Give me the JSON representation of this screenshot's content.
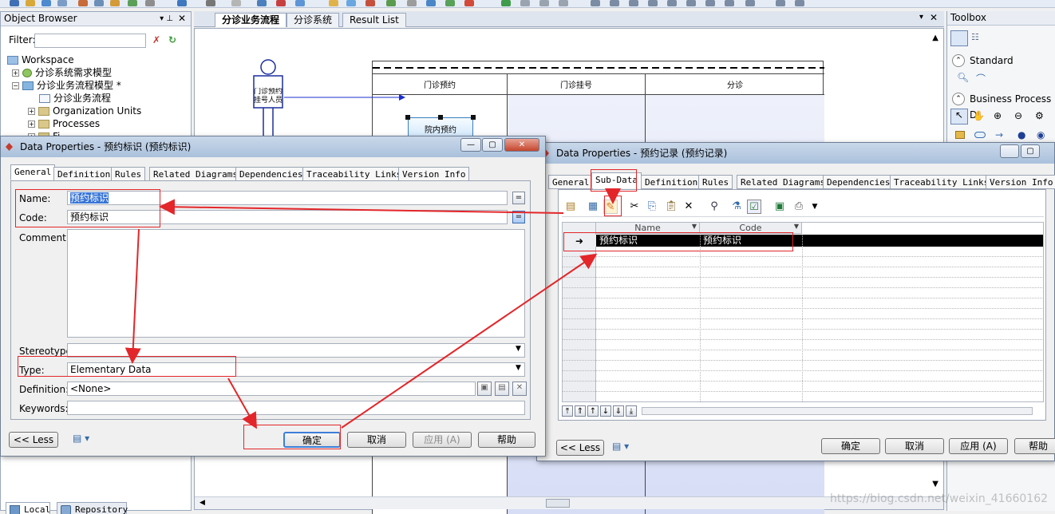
{
  "object_browser": {
    "title": "Object Browser",
    "filter_label": "Filter:",
    "filter_value": "",
    "tree": [
      {
        "label": "Workspace",
        "depth": 0
      },
      {
        "label": "分诊系统需求模型",
        "depth": 1
      },
      {
        "label": "分诊业务流程模型 *",
        "depth": 1
      },
      {
        "label": "分诊业务流程",
        "depth": 2
      },
      {
        "label": "Organization Units",
        "depth": 2
      },
      {
        "label": "Processes",
        "depth": 2
      },
      {
        "label": "Fi...",
        "depth": 2
      }
    ],
    "bottom_tabs": [
      "Local",
      "Repository"
    ]
  },
  "document_tabs": [
    "分诊业务流程",
    "分诊系统",
    "Result List"
  ],
  "diagram": {
    "lanes": [
      "门诊预约",
      "门诊挂号",
      "分诊"
    ],
    "actor_label": "门诊预约挂号人员",
    "process_label": "院内预约"
  },
  "toolbox": {
    "title": "Toolbox",
    "sections": [
      "Standard",
      "Business Process D"
    ]
  },
  "dialog_left": {
    "title": "Data Properties - 预约标识 (预约标识)",
    "tabs": [
      "General",
      "Definition",
      "Rules",
      "Related Diagrams",
      "Dependencies",
      "Traceability Links",
      "Version Info"
    ],
    "labels": {
      "name": "Name:",
      "code": "Code:",
      "comment": "Comment:",
      "stereotype": "Stereotype:",
      "type": "Type:",
      "definition": "Definition:",
      "keywords": "Keywords:"
    },
    "values": {
      "name": "预约标识",
      "code": "预约标识",
      "comment": "",
      "stereotype": "",
      "type": "Elementary Data",
      "definition": "<None>",
      "keywords": ""
    },
    "buttons": {
      "less": "<< Less",
      "ok": "确定",
      "cancel": "取消",
      "apply": "应用 (A)",
      "help": "帮助"
    }
  },
  "dialog_right": {
    "title": "Data Properties - 预约记录 (预约记录)",
    "tabs": [
      "General",
      "Sub-Data",
      "Definition",
      "Rules",
      "Related Diagrams",
      "Dependencies",
      "Traceability Links",
      "Version Info"
    ],
    "grid_headers": [
      "Name",
      "Code"
    ],
    "rows": [
      {
        "name": "预约标识",
        "code": "预约标识"
      }
    ],
    "buttons": {
      "less": "<< Less",
      "ok": "确定",
      "cancel": "取消",
      "apply": "应用 (A)",
      "help": "帮助"
    }
  },
  "watermark": "https://blog.csdn.net/weixin_41660162",
  "colors": {
    "annotation_red": "#e3262a",
    "selected_row": "#000000",
    "lane_fill": "#dde3f8"
  }
}
